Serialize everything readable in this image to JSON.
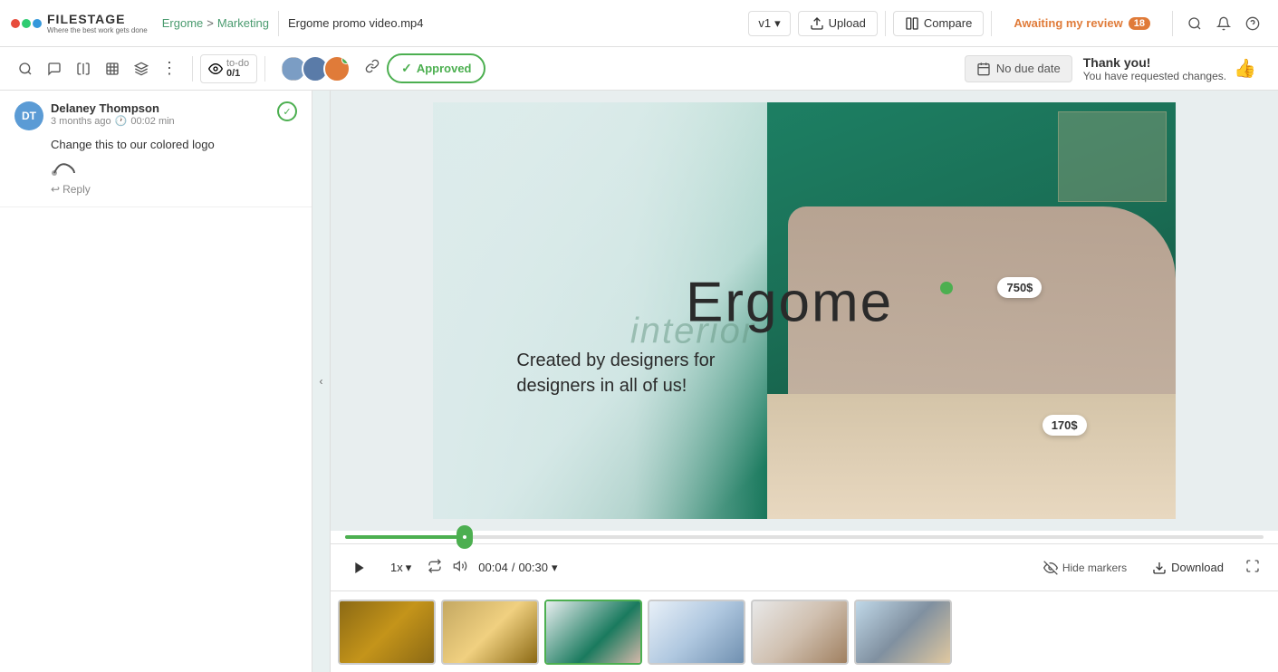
{
  "app": {
    "logo_name": "FILESTAGE",
    "logo_tagline": "Where the best work gets done"
  },
  "breadcrumb": {
    "link": "Ergome",
    "separator": ">",
    "section": "Marketing"
  },
  "file": {
    "name": "Ergome promo video.mp4"
  },
  "version": {
    "label": "v1",
    "chevron": "▾"
  },
  "toolbar": {
    "upload_label": "Upload",
    "compare_label": "Compare",
    "awaiting_review": "Awaiting my review",
    "review_count": "18",
    "todo_label": "to-do",
    "todo_count": "0/1",
    "approved_label": "Approved",
    "no_due_date": "No due date",
    "thank_you_title": "Thank you!",
    "thank_you_sub": "You have requested changes."
  },
  "comment": {
    "author": "Delaney Thompson",
    "time": "3 months ago",
    "timestamp": "00:02 min",
    "text": "Change this to our colored logo",
    "reply_label": "Reply"
  },
  "video": {
    "text_interior": "interior",
    "text_ergome": "Ergome",
    "text_subtitle_1": "Created by designers for",
    "text_subtitle_2": "designers in all of us!",
    "price_750": "750$",
    "price_170": "170$"
  },
  "controls": {
    "speed": "1x",
    "time_current": "00:04",
    "time_separator": "/",
    "time_total": "00:30",
    "progress_percent": 13,
    "hide_markers": "Hide markers",
    "download": "Download"
  },
  "thumbnails": [
    {
      "id": 1,
      "class": "thumb-1",
      "active": false
    },
    {
      "id": 2,
      "class": "thumb-2",
      "active": false
    },
    {
      "id": 3,
      "class": "thumb-3",
      "active": true
    },
    {
      "id": 4,
      "class": "thumb-4",
      "active": false
    },
    {
      "id": 5,
      "class": "thumb-5",
      "active": false
    },
    {
      "id": 6,
      "class": "thumb-6",
      "active": false
    }
  ]
}
